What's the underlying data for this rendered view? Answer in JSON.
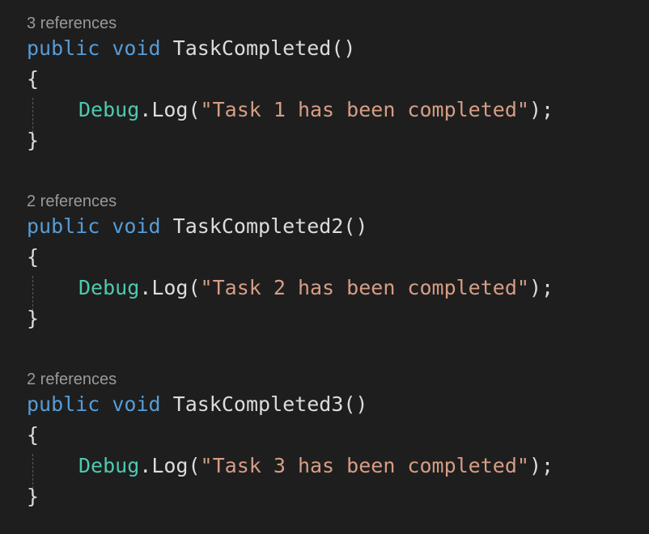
{
  "colors": {
    "background": "#1e1e1e",
    "keyword": "#569cd6",
    "type": "#4ec9b0",
    "string": "#d69d85",
    "default": "#dcdcdc",
    "codelens": "#999999"
  },
  "methods": [
    {
      "references": "3 references",
      "kw_public": "public",
      "kw_void": "void",
      "name": "TaskCompleted",
      "parens": "()",
      "open_brace": "{",
      "debug": "Debug",
      "dot": ".",
      "log": "Log",
      "open_paren": "(",
      "string": "\"Task 1 has been completed\"",
      "close": ");",
      "close_brace": "}"
    },
    {
      "references": "2 references",
      "kw_public": "public",
      "kw_void": "void",
      "name": "TaskCompleted2",
      "parens": "()",
      "open_brace": "{",
      "debug": "Debug",
      "dot": ".",
      "log": "Log",
      "open_paren": "(",
      "string": "\"Task 2 has been completed\"",
      "close": ");",
      "close_brace": "}"
    },
    {
      "references": "2 references",
      "kw_public": "public",
      "kw_void": "void",
      "name": "TaskCompleted3",
      "parens": "()",
      "open_brace": "{",
      "debug": "Debug",
      "dot": ".",
      "log": "Log",
      "open_paren": "(",
      "string": "\"Task 3 has been completed\"",
      "close": ");",
      "close_brace": "}"
    }
  ]
}
